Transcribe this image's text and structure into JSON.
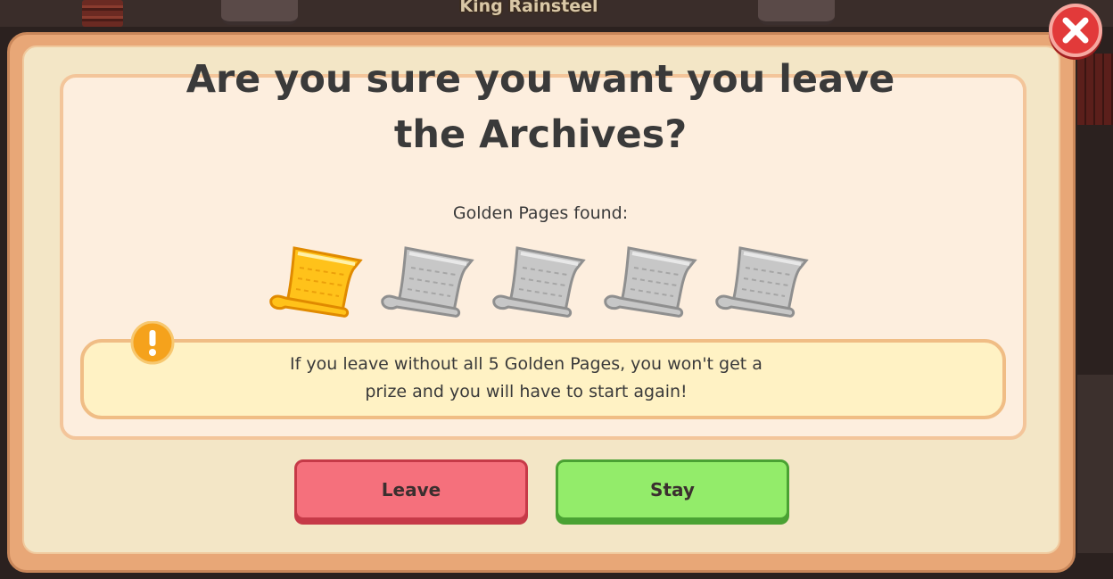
{
  "scene": {
    "npc_name": "King Rainsteel"
  },
  "dialog": {
    "title_line1": "Are you sure you want you leave",
    "title_line2": "the Archives?",
    "subtitle": "Golden Pages found:",
    "pages": [
      {
        "name": "golden-page-1",
        "found": true
      },
      {
        "name": "golden-page-2",
        "found": false
      },
      {
        "name": "golden-page-3",
        "found": false
      },
      {
        "name": "golden-page-4",
        "found": false
      },
      {
        "name": "golden-page-5",
        "found": false
      }
    ],
    "pages_found": 1,
    "pages_total": 5,
    "warning_line1": "If you leave without all 5 Golden Pages, you won't get a",
    "warning_line2": "prize and you will have to start again!",
    "warning_icon": "exclamation-icon",
    "close_icon": "close-icon"
  },
  "buttons": {
    "leave_label": "Leave",
    "stay_label": "Stay"
  },
  "colors": {
    "leave": "#f5707c",
    "stay": "#93ec6a",
    "gold_page": "#ffc21a",
    "empty_page": "#c7c7c7",
    "close": "#e23a3a"
  }
}
